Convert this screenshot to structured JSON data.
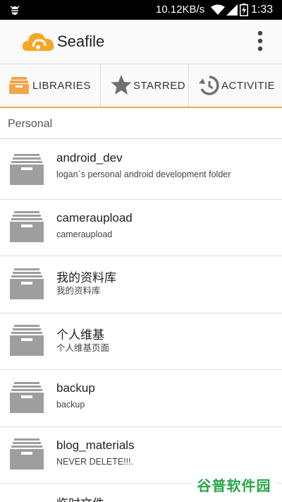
{
  "status_bar": {
    "speed": "10.12KB/s",
    "time": "1:33"
  },
  "action_bar": {
    "title": "Seafile",
    "logo_icon": "seafile-cloud-logo-icon",
    "overflow_icon": "overflow-menu-icon"
  },
  "tabs": [
    {
      "label": "LIBRARIES",
      "icon": "libraries-icon",
      "selected": true
    },
    {
      "label": "STARRED",
      "icon": "star-icon",
      "selected": false
    },
    {
      "label": "ACTIVITIE",
      "icon": "history-icon",
      "selected": false
    }
  ],
  "section": {
    "title": "Personal"
  },
  "libraries": [
    {
      "name": "android_dev",
      "desc": "logan`s personal android development folder"
    },
    {
      "name": "cameraupload",
      "desc": "cameraupload"
    },
    {
      "name": "我的资料库",
      "desc": "我的资料库"
    },
    {
      "name": "个人维基",
      "desc": "个人维基页面"
    },
    {
      "name": "backup",
      "desc": "backup"
    },
    {
      "name": "blog_materials",
      "desc": "NEVER DELETE!!!."
    },
    {
      "name": "临时文件",
      "desc": ""
    }
  ],
  "watermark": "谷普软件园",
  "colors": {
    "accent": "#f0a64a",
    "icon_gray": "#9e9e9e"
  }
}
